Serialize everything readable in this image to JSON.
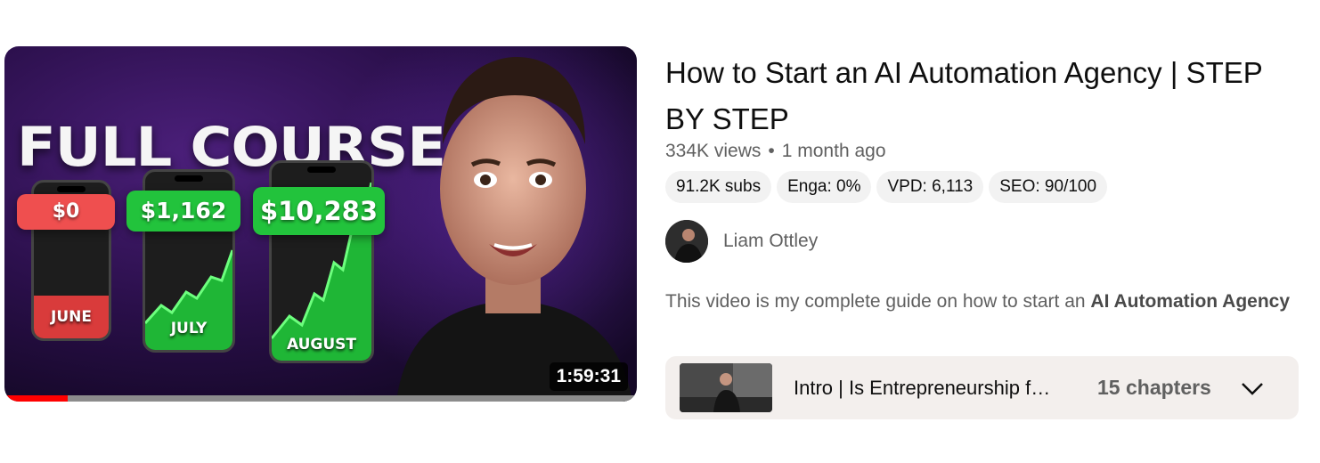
{
  "thumbnail": {
    "headline": "FULL COURSE",
    "amounts": [
      "$0",
      "$1,162",
      "$10,283"
    ],
    "months": [
      "JUNE",
      "JULY",
      "AUGUST"
    ],
    "duration": "1:59:31",
    "watched_fraction": 0.1
  },
  "video": {
    "title": "How to Start an AI Automation Agency | STEP BY STEP",
    "views": "334K views",
    "separator": "•",
    "age": "1 month ago"
  },
  "badges": [
    "91.2K subs",
    "Enga: 0%",
    "VPD: 6,113",
    "SEO: 90/100"
  ],
  "channel": {
    "name": "Liam Ottley"
  },
  "description": {
    "prefix": "This video is my complete guide on how to start an ",
    "bold": "AI Automation Agency"
  },
  "chapters": {
    "first": "Intro | Is Entrepreneurship for you?",
    "count_label": "15 chapters",
    "expand_icon": "chevron-down-icon"
  },
  "colors": {
    "progress": "#ff0000",
    "money_green": "#22c33c",
    "money_red": "#ef4f4f"
  }
}
